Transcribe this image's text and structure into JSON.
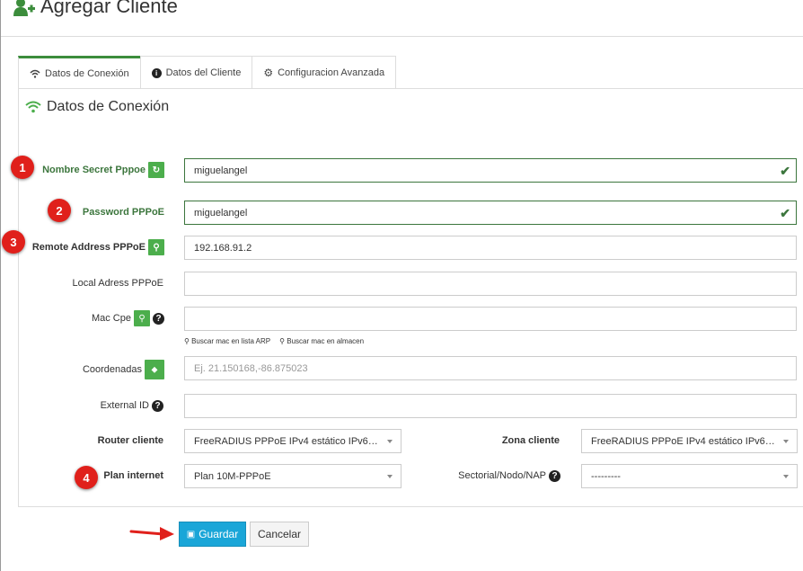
{
  "header": {
    "title": "Agregar Cliente",
    "icon": "user-plus-icon"
  },
  "tabs": [
    {
      "label": "Datos de Conexión",
      "icon": "wifi-icon",
      "active": true
    },
    {
      "label": "Datos del Cliente",
      "icon": "info-icon"
    },
    {
      "label": "Configuracion Avanzada",
      "icon": "gear-icon"
    }
  ],
  "section": {
    "title": "Datos de Conexión"
  },
  "fields": {
    "secret": {
      "label": "Nombre Secret Pppoe",
      "value": "miguelangel"
    },
    "password": {
      "label": "Password PPPoE",
      "value": "miguelangel"
    },
    "remote": {
      "label": "Remote Address PPPoE",
      "value": "192.168.91.2"
    },
    "local": {
      "label": "Local Adress PPPoE",
      "value": ""
    },
    "mac": {
      "label": "Mac Cpe",
      "value": ""
    },
    "coords": {
      "label": "Coordenadas",
      "placeholder": "Ej. 21.150168,-86.875023"
    },
    "external": {
      "label": "External ID",
      "value": ""
    },
    "router": {
      "label": "Router cliente",
      "value": "FreeRADIUS PPPoE IPv4 estático IPv6…"
    },
    "zona": {
      "label": "Zona cliente",
      "value": "FreeRADIUS PPPoE IPv4 estático IPv6…"
    },
    "plan": {
      "label": "Plan internet",
      "value": "Plan 10M-PPPoE"
    },
    "sectorial": {
      "label": "Sectorial/Nodo/NAP",
      "value": "---------"
    }
  },
  "mac_links": {
    "arp": "Buscar mac en lista ARP",
    "almacen": "Buscar mac en almacen"
  },
  "badges": [
    "1",
    "2",
    "3",
    "4"
  ],
  "buttons": {
    "save": "Guardar",
    "cancel": "Cancelar"
  },
  "colors": {
    "accent": "#3c8d3c",
    "badge": "#e0201b",
    "save": "#1aa6d8"
  }
}
